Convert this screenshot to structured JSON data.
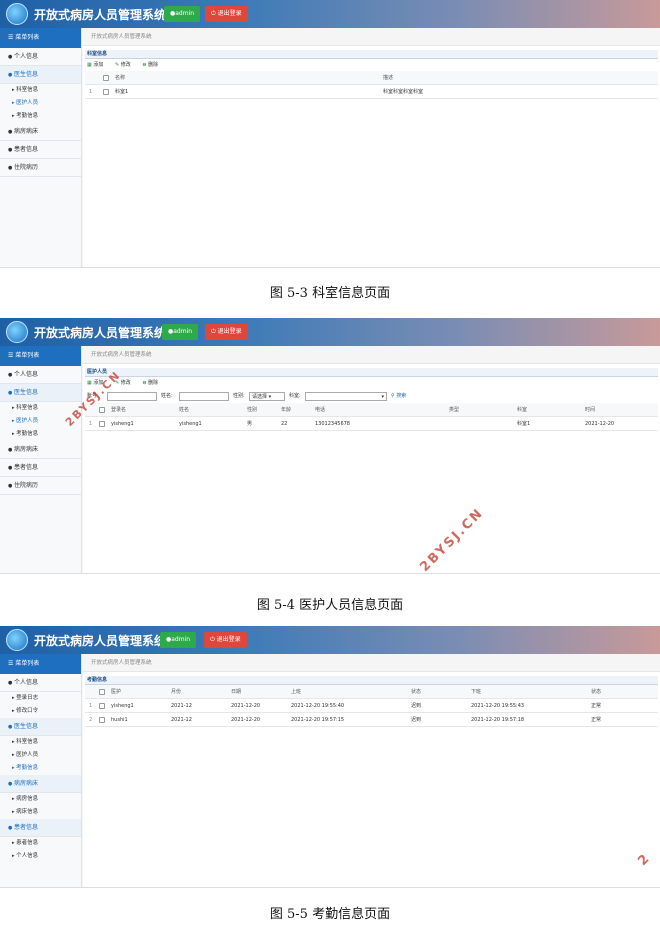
{
  "app": {
    "title": "开放式病房人员管理系统",
    "admin_label": "admin",
    "logout_label": "退出登录",
    "menu_title": "菜单列表",
    "breadcrumb": "开放式病房人员管理系统"
  },
  "sidebar": {
    "s1": [
      {
        "label": "个人信息",
        "type": "sec"
      },
      {
        "label": "医生信息",
        "type": "sec-blue"
      },
      {
        "label": "科室信息",
        "type": "item"
      },
      {
        "label": "医护人员",
        "type": "item-active"
      },
      {
        "label": "考勤信息",
        "type": "item"
      },
      {
        "label": "病房病床",
        "type": "sec"
      },
      {
        "label": "患者信息",
        "type": "sec"
      },
      {
        "label": "住院病历",
        "type": "sec"
      }
    ],
    "s2": [
      {
        "label": "个人信息",
        "type": "sec"
      },
      {
        "label": "医生信息",
        "type": "sec-blue"
      },
      {
        "label": "科室信息",
        "type": "item"
      },
      {
        "label": "医护人员",
        "type": "item-active"
      },
      {
        "label": "考勤信息",
        "type": "item"
      },
      {
        "label": "病房病床",
        "type": "sec"
      },
      {
        "label": "患者信息",
        "type": "sec"
      },
      {
        "label": "住院病历",
        "type": "sec"
      }
    ],
    "s3": [
      {
        "label": "个人信息",
        "type": "sec"
      },
      {
        "label": "登录日志",
        "type": "item"
      },
      {
        "label": "修改口令",
        "type": "item"
      },
      {
        "label": "医生信息",
        "type": "sec-blue"
      },
      {
        "label": "科室信息",
        "type": "item"
      },
      {
        "label": "医护人员",
        "type": "item"
      },
      {
        "label": "考勤信息",
        "type": "item-active"
      },
      {
        "label": "病房病床",
        "type": "sec-blue"
      },
      {
        "label": "病房信息",
        "type": "item"
      },
      {
        "label": "病床信息",
        "type": "item"
      },
      {
        "label": "患者信息",
        "type": "sec-blue"
      },
      {
        "label": "患者信息",
        "type": "item"
      },
      {
        "label": "个人信息",
        "type": "item"
      }
    ]
  },
  "toolbar": {
    "add": "添加",
    "edit": "修改",
    "delete": "删除"
  },
  "section1": {
    "panel_title": "科室信息",
    "columns": [
      "名称",
      "描述"
    ],
    "rows": [
      {
        "num": "1",
        "name": "科室1",
        "desc": "科室科室科室科室"
      }
    ],
    "caption": "图 5-3 科室信息页面"
  },
  "section2": {
    "panel_title": "医护人员",
    "search": {
      "account_label": "账号:",
      "name_label": "姓名:",
      "gender_label": "性别:",
      "gender_value": "请选择",
      "dept_label": "科室:",
      "search_btn": "搜索"
    },
    "columns": [
      "登录名",
      "姓名",
      "性别",
      "年龄",
      "电话",
      "类型",
      "科室",
      "时间"
    ],
    "rows": [
      {
        "num": "1",
        "login": "yisheng1",
        "name": "yisheng1",
        "gender": "男",
        "age": "22",
        "phone": "13012345678",
        "type": "",
        "dept": "科室1",
        "time": "2021-12-20"
      }
    ],
    "caption": "图 5-4 医护人员信息页面"
  },
  "section3": {
    "panel_title": "考勤信息",
    "columns": [
      "医护",
      "月份",
      "日期",
      "上班",
      "状态",
      "下班",
      "状态"
    ],
    "rows": [
      {
        "num": "1",
        "staff": "yisheng1",
        "month": "2021-12",
        "date": "2021-12-20",
        "on": "2021-12-20 19:55:40",
        "on_status": "迟到",
        "off": "2021-12-20 19:55:43",
        "off_status": "正常"
      },
      {
        "num": "2",
        "staff": "hushi1",
        "month": "2021-12",
        "date": "2021-12-20",
        "on": "2021-12-20 19:57:15",
        "on_status": "迟到",
        "off": "2021-12-20 19:57:18",
        "off_status": "正常"
      }
    ],
    "caption": "图 5-5 考勤信息页面"
  },
  "watermarks": {
    "w1": "2BYSJ.CN",
    "w2": "2BYSJ.CN",
    "w3": "2"
  }
}
